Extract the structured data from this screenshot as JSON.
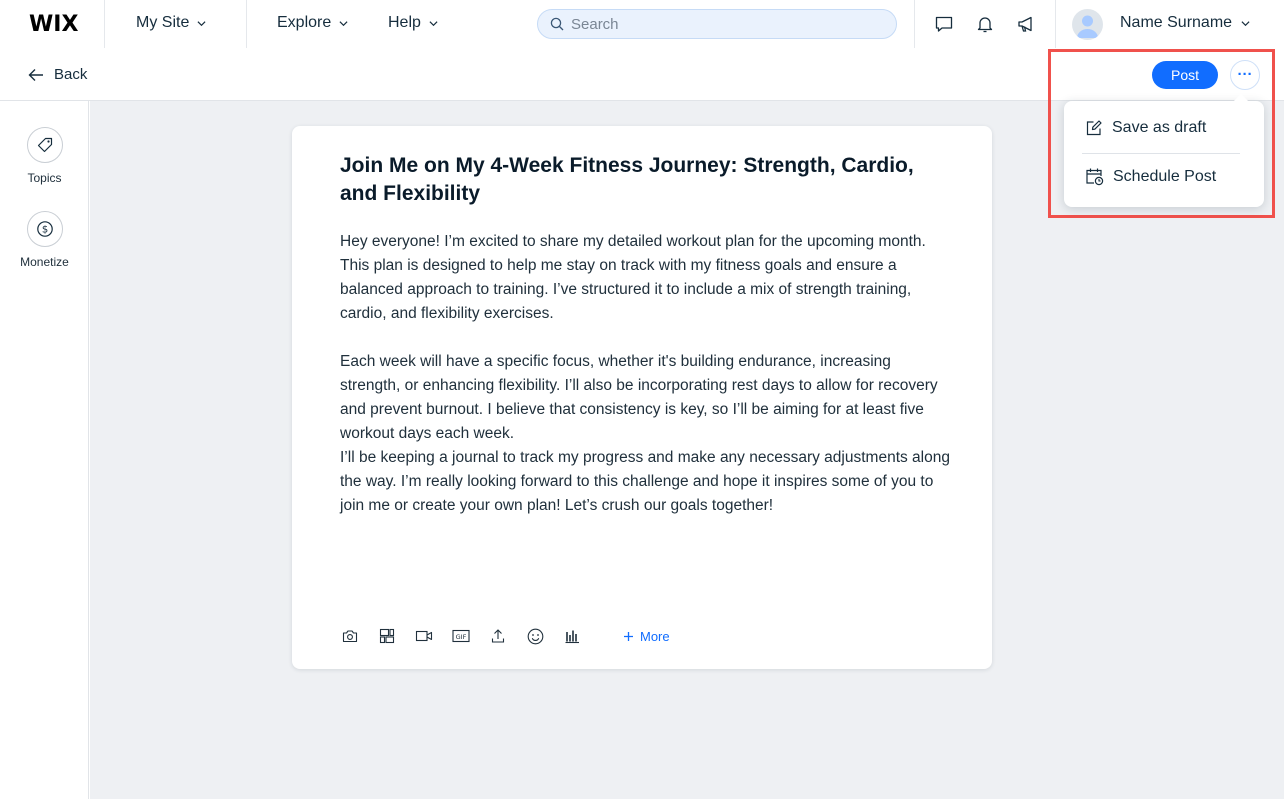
{
  "app": {
    "logo": "WIX",
    "site_menu": "My Site",
    "explore": "Explore",
    "help": "Help",
    "search_placeholder": "Search",
    "user_name": "Name Surname"
  },
  "subbar": {
    "back_label": "Back",
    "post_label": "Post",
    "more_label": "···"
  },
  "sidebar": {
    "items": [
      {
        "label": "Topics",
        "icon": "tag-icon"
      },
      {
        "label": "Monetize",
        "icon": "dollar-icon"
      }
    ]
  },
  "post": {
    "title": "Join Me on My 4-Week Fitness Journey: Strength, Cardio, and Flexibility",
    "paragraphs": [
      "Hey everyone! I’m excited to share my detailed workout plan for the upcoming month. This plan is designed to help me stay on track with my fitness goals and ensure a balanced approach to training. I’ve structured it to include a mix of strength training, cardio, and flexibility exercises.",
      "Each week will have a specific focus, whether it's building endurance, increasing strength, or enhancing flexibility. I’ll also be incorporating rest days to allow for recovery and prevent burnout. I believe that consistency is key, so I’ll be aiming for at least five workout days each week.",
      "I’ll be keeping a journal to track my progress and make any necessary adjustments along the way. I’m really looking forward to this challenge and hope it inspires some of you to join me or create your own plan! Let’s crush our goals together!"
    ],
    "toolbar_more": "More"
  },
  "dropdown": {
    "items": [
      {
        "label": "Save as draft",
        "icon": "edit-icon"
      },
      {
        "label": "Schedule Post",
        "icon": "calendar-clock-icon"
      }
    ]
  },
  "colors": {
    "accent": "#116dff",
    "highlight": "#f0514c",
    "canvas": "#eef0f3"
  }
}
